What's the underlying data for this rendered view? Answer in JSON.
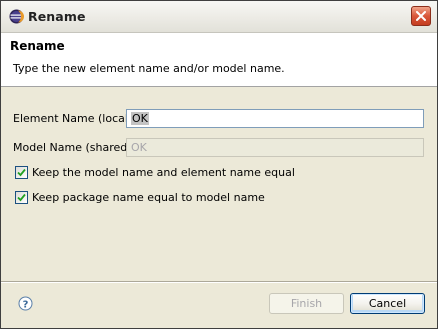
{
  "window": {
    "title": "Rename",
    "app_icon": "eclipse-icon",
    "close_icon": "close-icon"
  },
  "header": {
    "title": "Rename",
    "message": "Type the new element name and/or model name."
  },
  "form": {
    "element_name": {
      "label": "Element Name (local):",
      "value": "OK"
    },
    "model_name": {
      "label": "Model Name (shared):",
      "value": "OK",
      "enabled": false
    },
    "keep_equal": {
      "label": "Keep the model name and element name equal",
      "checked": true
    },
    "keep_package": {
      "label": "Keep package name equal to model name",
      "checked": true
    }
  },
  "footer": {
    "help_icon": "help-icon",
    "finish_label": "Finish",
    "finish_enabled": false,
    "cancel_label": "Cancel"
  },
  "colors": {
    "accent": "#1c5180",
    "disabled_text": "#a7a6aa",
    "dialog_bg": "#ece9d8"
  }
}
